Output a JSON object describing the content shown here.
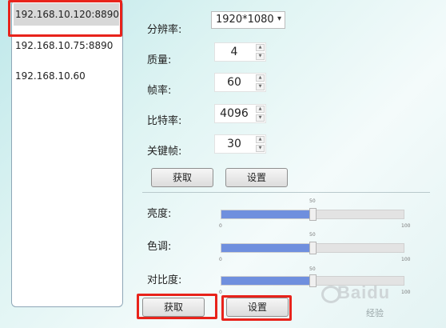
{
  "ip_list": {
    "items": [
      {
        "label": "192.168.10.120:8890",
        "selected": true
      },
      {
        "label": "192.168.10.75:8890",
        "selected": false
      },
      {
        "label": "192.168.10.60",
        "selected": false
      }
    ]
  },
  "video_settings": {
    "resolution_label": "分辨率:",
    "resolution_value": "1920*1080",
    "quality_label": "质量:",
    "quality_value": "4",
    "framerate_label": "帧率:",
    "framerate_value": "60",
    "bitrate_label": "比特率:",
    "bitrate_value": "4096",
    "keyframe_label": "关键帧:",
    "keyframe_value": "30",
    "get_button": "获取",
    "set_button": "设置"
  },
  "image_settings": {
    "brightness_label": "亮度:",
    "brightness_value": 50,
    "hue_label": "色调:",
    "hue_value": 50,
    "contrast_label": "对比度:",
    "contrast_value": 50,
    "slider_min": "0",
    "slider_mid": "50",
    "slider_max": "100",
    "get_button": "获取",
    "set_button": "设置"
  },
  "highlight_color": "#e8231b",
  "slider_fill_color": "#6f8fde",
  "watermark": {
    "brand": "Baidu",
    "text": "经验"
  }
}
